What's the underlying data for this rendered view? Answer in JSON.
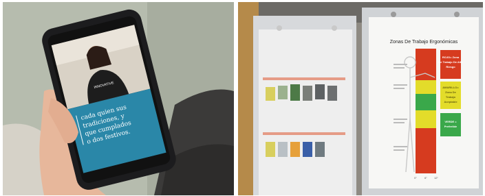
{
  "left_photo": {
    "shirt_text": "INNOVATIVE",
    "caption_lines": [
      "cada quien sus",
      "tradiciones, y",
      "que cumplados",
      "o dos festivos."
    ]
  },
  "right_photo": {
    "chart_title": "Zonas De Trabajo Ergonómicas",
    "zone_labels": [
      {
        "lines": [
          "ROJO= Zona",
          "De Trabajo De Alto",
          "Riesgo"
        ]
      },
      {
        "lines": [
          "AMARILLO=",
          "Zona De",
          "Trabajo",
          "Aceptable"
        ]
      },
      {
        "lines": [
          "VERDE =",
          "Preferible"
        ]
      }
    ],
    "axis_labels": [
      "0\"",
      "6\"",
      "12\""
    ],
    "colors": {
      "red": "#d63b1f",
      "yellow": "#e3dc2a",
      "green": "#3aa84a",
      "teal": "#2a87a8"
    }
  }
}
